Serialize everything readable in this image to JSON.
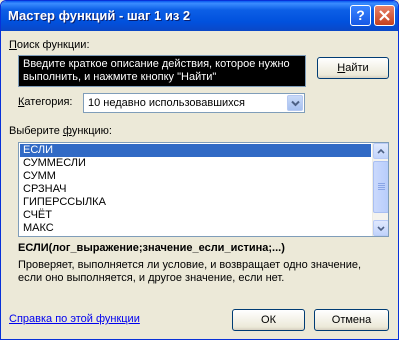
{
  "window": {
    "title": "Мастер функций - шаг 1 из 2",
    "help_symbol": "?"
  },
  "search": {
    "label_prefix": "",
    "label_key": "П",
    "label_rest": "оиск функции:",
    "value": "Введите краткое описание действия, которое нужно выполнить, и нажмите кнопку \"Найти\"",
    "find_key": "Н",
    "find_rest": "айти"
  },
  "category": {
    "label_key": "К",
    "label_rest": "атегория:",
    "selected": "10 недавно использовавшихся"
  },
  "functions": {
    "label_prefix": "Выберите ",
    "label_key": "ф",
    "label_rest": "ункцию:",
    "items": [
      "ЕСЛИ",
      "СУММЕСЛИ",
      "СУММ",
      "СРЗНАЧ",
      "ГИПЕРССЫЛКА",
      "СЧЁТ",
      "МАКС"
    ],
    "selected_index": 0,
    "scroll_fraction": 0
  },
  "details": {
    "signature": "ЕСЛИ(лог_выражение;значение_если_истина;...)",
    "description": "Проверяет, выполняется ли условие, и возвращает одно значение, если оно выполняется, и другое значение, если нет."
  },
  "footer": {
    "help_link": "Справка по этой функции",
    "ok": "ОК",
    "cancel": "Отмена"
  },
  "colors": {
    "selection": "#316ac5",
    "titlebar": "#0151dd",
    "link": "#0000ee"
  }
}
